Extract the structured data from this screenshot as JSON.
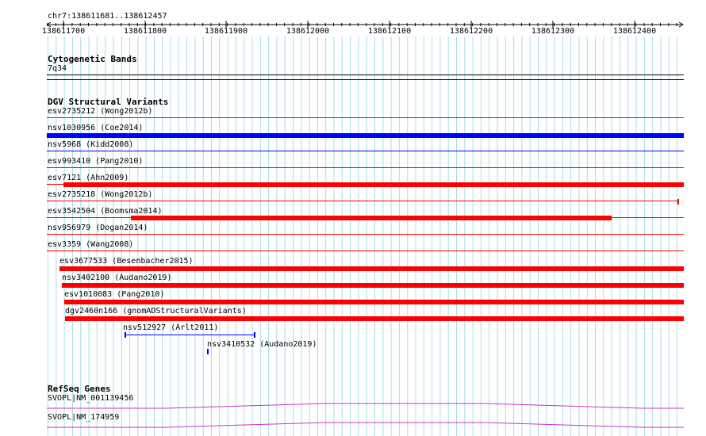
{
  "ruler": {
    "location": "chr7:138611681..138612457",
    "ticks": [
      "138611700",
      "138611800",
      "138611900",
      "138612000",
      "138612100",
      "138612200",
      "138612300",
      "138612400"
    ]
  },
  "tracks": {
    "cytoband": {
      "title": "Cytogenetic Bands",
      "band": "7q34"
    },
    "dgv": {
      "title": "DGV Structural Variants",
      "variants": [
        {
          "label": "esv2735212 (Wong2012b)",
          "color": "#ff0000"
        },
        {
          "label": "nsv1030956 (Coe2014)",
          "color": "#0000ff"
        },
        {
          "label": "nsv5968 (Kidd2008)",
          "color": "#0000ff"
        },
        {
          "label": "esv993410 (Pang2010)",
          "color": "#ff0000"
        },
        {
          "label": "esv7121 (Ahn2009)",
          "color": "#ff0000"
        },
        {
          "label": "esv2735218 (Wong2012b)",
          "color": "#ff0000"
        },
        {
          "label": "esv3542504 (Boomsma2014)",
          "color": "#ff0000"
        },
        {
          "label": "nsv956979 (Dogan2014)",
          "color": "#ff0000"
        },
        {
          "label": "esv3359 (Wang2008)",
          "color": "#ff0000"
        },
        {
          "label": "esv3677533 (Besenbacher2015)",
          "color": "#ff0000"
        },
        {
          "label": "nsv3402100 (Audano2019)",
          "color": "#ff0000"
        },
        {
          "label": "esv1010083 (Pang2010)",
          "color": "#ff0000"
        },
        {
          "label": "dgv2460n166 (gnomADStructuralVariants)",
          "color": "#ff0000"
        },
        {
          "label": "nsv512927 (Arlt2011)",
          "color": "#0000ff"
        },
        {
          "label": "nsv3410532 (Audano2019)",
          "color": "#0000ff"
        }
      ]
    },
    "refseq": {
      "title": "RefSeq Genes",
      "genes": [
        {
          "label": "SVOPL|NM_001139456",
          "color": "#cc33cc"
        },
        {
          "label": "SVOPL|NM_174959",
          "color": "#cc33cc"
        }
      ]
    }
  }
}
